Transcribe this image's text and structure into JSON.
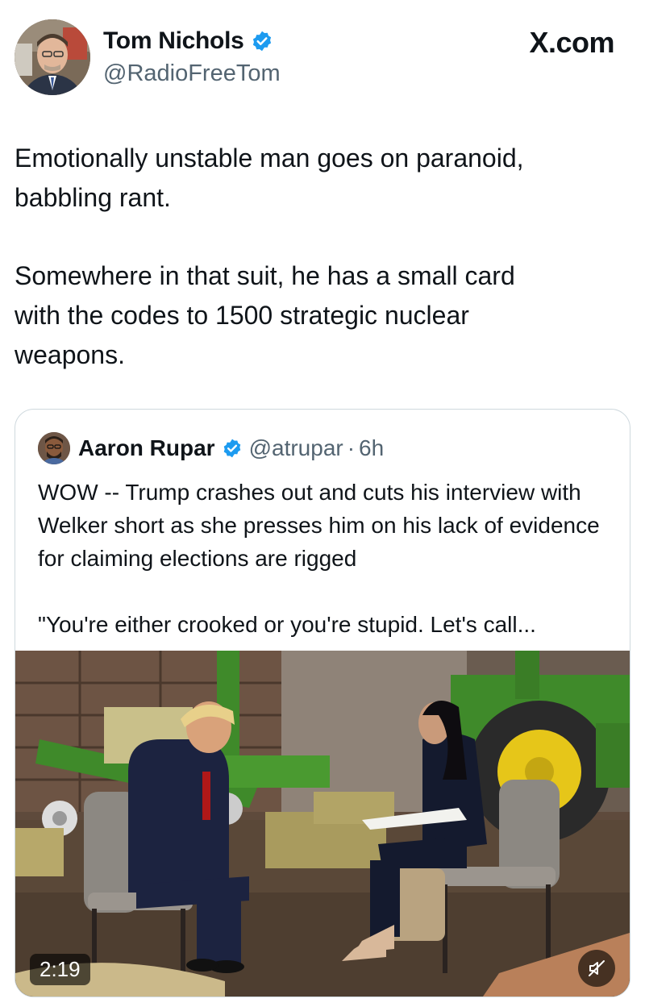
{
  "author": {
    "name": "Tom Nichols",
    "handle": "@RadioFreeTom",
    "verified": true,
    "avatar_icon": "profile-photo"
  },
  "brand": {
    "label": "X.com"
  },
  "tweet": {
    "paragraphs": [
      "Emotionally unstable man goes on paranoid,\nbabbling rant.",
      "Somewhere in that suit, he has a small card\nwith the codes to 1500 strategic nuclear\nweapons."
    ]
  },
  "quoted": {
    "name": "Aaron Rupar",
    "handle": "@atrupar",
    "separator": "·",
    "time": "6h",
    "verified": true,
    "paragraphs": [
      "WOW -- Trump crashes out and cuts his interview with Welker short as she presses him on his lack of evidence for claiming elections are rigged",
      "\"You're either crooked or you're stupid. Let's call..."
    ],
    "video": {
      "duration": "2:19",
      "mute_icon": "speaker-muted-icon"
    }
  },
  "colors": {
    "text": "#0f1419",
    "secondary": "#536471",
    "verified": "#1d9bf0",
    "border": "#cfd9de"
  }
}
